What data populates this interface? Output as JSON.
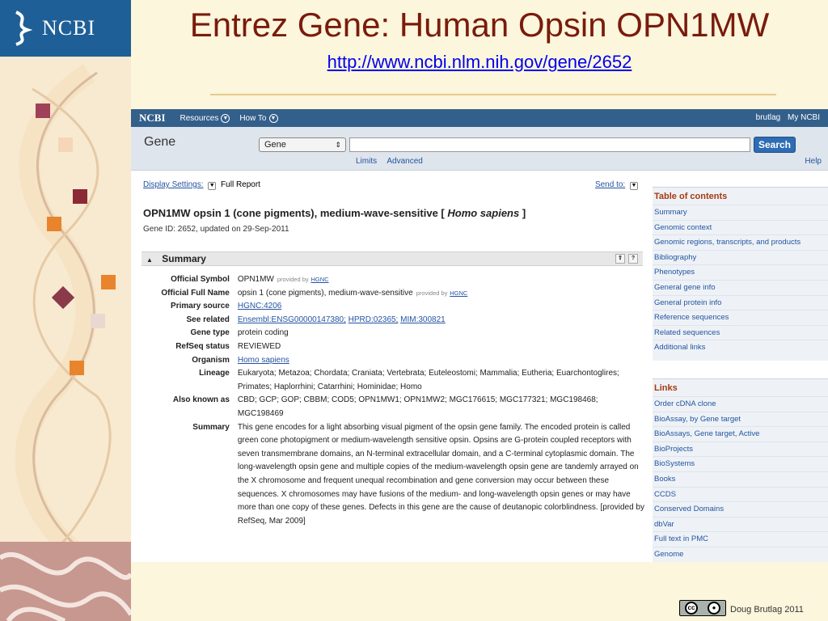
{
  "sidebar_logo": {
    "text": "NCBI"
  },
  "slide": {
    "title": "Entrez Gene: Human Opsin OPN1MW",
    "url": "http://www.ncbi.nlm.nih.gov/gene/2652"
  },
  "ncbi": {
    "nav": {
      "logo": "NCBI",
      "resources": "Resources",
      "howto": "How To",
      "user": "brutlag",
      "my_ncbi": "My NCBI"
    },
    "search": {
      "heading": "Gene",
      "database": "Gene",
      "button": "Search",
      "limits": "Limits",
      "advanced": "Advanced",
      "help": "Help"
    },
    "display": {
      "settings_label": "Display Settings:",
      "report": "Full Report",
      "send_to": "Send to:"
    },
    "record": {
      "title_prefix": "OPN1MW opsin 1 (cone pigments), medium-wave-sensitive [ ",
      "species": "Homo sapiens",
      "title_suffix": " ]",
      "gene_id": "Gene ID: 2652, updated on 29-Sep-2011"
    },
    "summary": {
      "header": "Summary",
      "official_symbol": {
        "label": "Official Symbol",
        "value": "OPN1MW",
        "provided_by": "provided by",
        "source": "HGNC"
      },
      "official_full_name": {
        "label": "Official Full Name",
        "value": "opsin 1 (cone pigments), medium-wave-sensitive",
        "provided_by": "provided by",
        "source": "HGNC"
      },
      "primary_source": {
        "label": "Primary source",
        "value": "HGNC:4206"
      },
      "see_related": {
        "label": "See related",
        "links": [
          "Ensembl:ENSG00000147380;",
          "HPRD:02365;",
          "MIM:300821"
        ]
      },
      "gene_type": {
        "label": "Gene type",
        "value": "protein coding"
      },
      "refseq_status": {
        "label": "RefSeq status",
        "value": "REVIEWED"
      },
      "organism": {
        "label": "Organism",
        "value": "Homo sapiens"
      },
      "lineage": {
        "label": "Lineage",
        "value": "Eukaryota; Metazoa; Chordata; Craniata; Vertebrata; Euteleostomi; Mammalia; Eutheria; Euarchontoglires; Primates; Haplorrhini; Catarrhini; Hominidae; Homo"
      },
      "also_known_as": {
        "label": "Also known as",
        "value": "CBD; GCP; GOP; CBBM; COD5; OPN1MW1; OPN1MW2; MGC176615; MGC177321; MGC198468; MGC198469"
      },
      "summary_text": {
        "label": "Summary",
        "value": "This gene encodes for a light absorbing visual pigment of the opsin gene family. The encoded protein is called green cone photopigment or medium-wavelength sensitive opsin. Opsins are G-protein coupled receptors with seven transmembrane domains, an N-terminal extracellular domain, and a C-terminal cytoplasmic domain. The long-wavelength opsin gene and multiple copies of the medium-wavelength opsin gene are tandemly arrayed on the X chromosome and frequent unequal recombination and gene conversion may occur between these sequences. X chromosomes may have fusions of the medium- and long-wavelength opsin genes or may have more than one copy of these genes. Defects in this gene are the cause of deutanopic colorblindness. [provided by RefSeq, Mar 2009]"
      }
    },
    "toc": {
      "title": "Table of contents",
      "items": [
        "Summary",
        "Genomic context",
        "Genomic regions, transcripts, and products",
        "Bibliography",
        "Phenotypes",
        "General gene info",
        "General protein info",
        "Reference sequences",
        "Related sequences",
        "Additional links"
      ]
    },
    "links": {
      "title": "Links",
      "items": [
        "Order cDNA clone",
        "BioAssay, by Gene target",
        "BioAssays, Gene target, Active",
        "BioProjects",
        "BioSystems",
        "Books",
        "CCDS",
        "Conserved Domains",
        "dbVar",
        "Full text in PMC",
        "Genome"
      ]
    }
  },
  "footer": {
    "license_badge": "cc",
    "credit": "Doug Brutlag 2011"
  },
  "colors": {
    "title": "#7a1b0c",
    "ncbi_blue": "#1f5f97",
    "nav_bar": "#335f8b",
    "link": "#2354a1",
    "section_title": "#a53a12"
  }
}
